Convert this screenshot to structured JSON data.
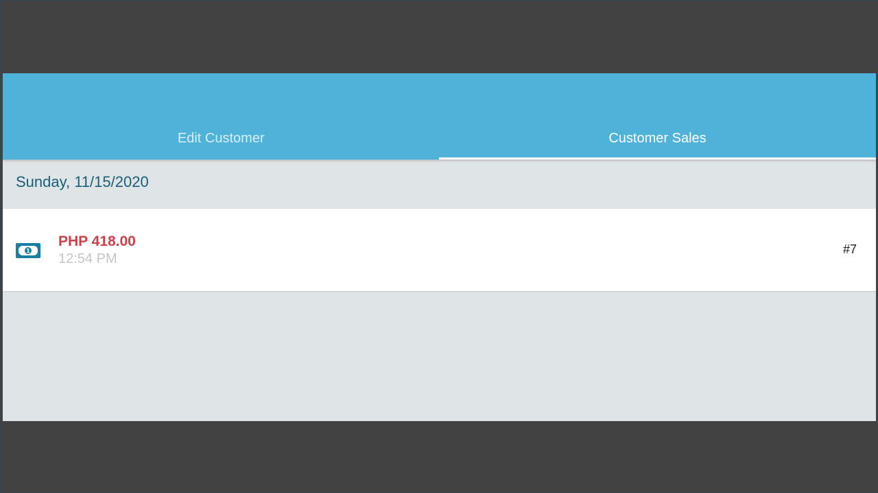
{
  "tabs": [
    {
      "label": "Edit Customer",
      "active": false
    },
    {
      "label": "Customer Sales",
      "active": true
    }
  ],
  "sales": {
    "date_header": "Sunday, 11/15/2020",
    "items": [
      {
        "icon": "cash-icon",
        "amount": "PHP 418.00",
        "time": "12:54 PM",
        "receipt_number": "#7"
      }
    ]
  },
  "colors": {
    "tab_bar": "#4fb3d9",
    "amount": "#c9414b",
    "date_text": "#1b5e7a",
    "icon": "#1b7fa3"
  }
}
